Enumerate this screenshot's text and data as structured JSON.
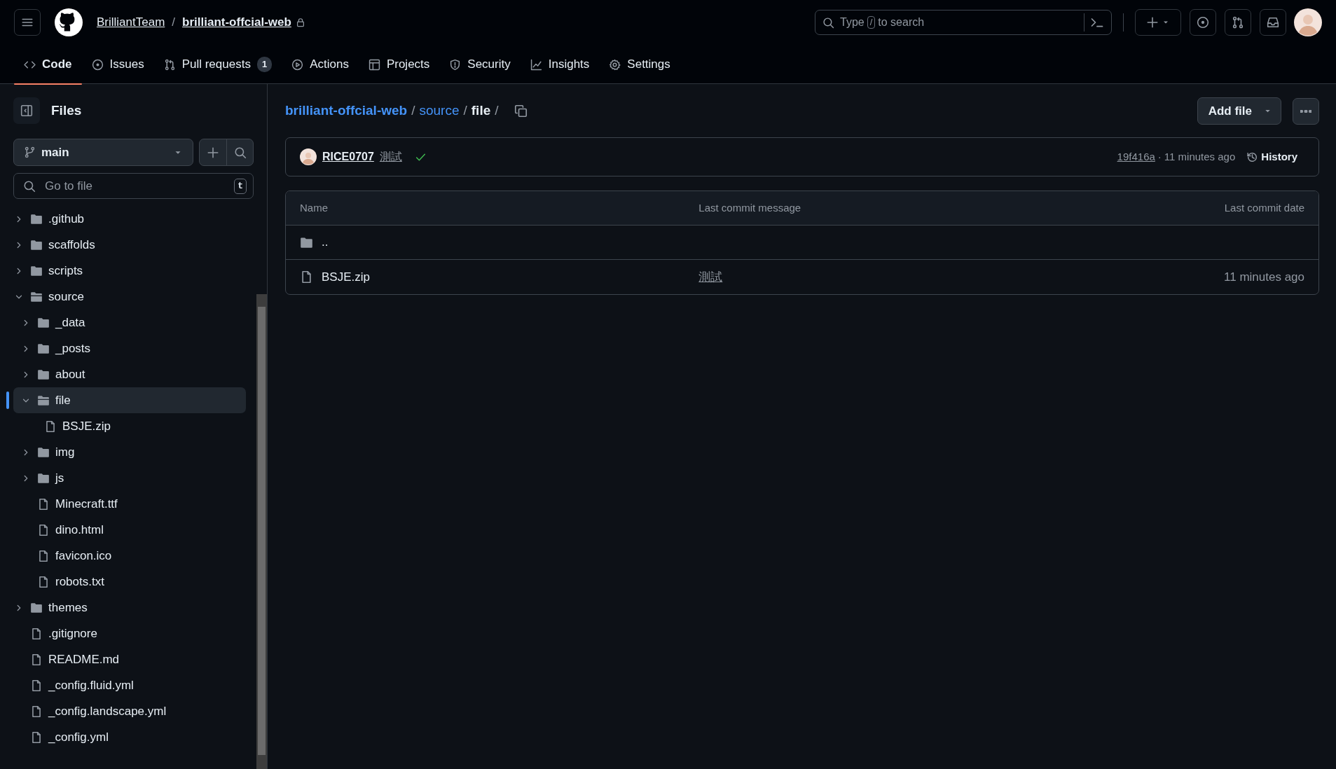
{
  "header": {
    "owner": "BrilliantTeam",
    "separator": "/",
    "repo": "brilliant-offcial-web",
    "private": true,
    "search": {
      "placeholder_before": "Type",
      "key": "/",
      "placeholder_after": "to search"
    }
  },
  "tabs": [
    {
      "label": "Code",
      "selected": true
    },
    {
      "label": "Issues",
      "selected": false
    },
    {
      "label": "Pull requests",
      "selected": false,
      "count": "1"
    },
    {
      "label": "Actions",
      "selected": false
    },
    {
      "label": "Projects",
      "selected": false
    },
    {
      "label": "Security",
      "selected": false
    },
    {
      "label": "Insights",
      "selected": false
    },
    {
      "label": "Settings",
      "selected": false
    }
  ],
  "sidebar": {
    "title": "Files",
    "branch": "main",
    "file_search": {
      "placeholder": "Go to file",
      "shortcut": "t"
    },
    "tree": [
      {
        "name": ".github",
        "kind": "folder",
        "expanded": false,
        "selected": false
      },
      {
        "name": "scaffolds",
        "kind": "folder",
        "expanded": false,
        "selected": false
      },
      {
        "name": "scripts",
        "kind": "folder",
        "expanded": false,
        "selected": false
      },
      {
        "name": "source",
        "kind": "folder",
        "expanded": true,
        "selected": false,
        "children": [
          {
            "name": "_data",
            "kind": "folder",
            "expanded": false,
            "selected": false
          },
          {
            "name": "_posts",
            "kind": "folder",
            "expanded": false,
            "selected": false
          },
          {
            "name": "about",
            "kind": "folder",
            "expanded": false,
            "selected": false
          },
          {
            "name": "file",
            "kind": "folder",
            "expanded": true,
            "selected": true,
            "children": [
              {
                "name": "BSJE.zip",
                "kind": "file",
                "selected": false
              }
            ]
          },
          {
            "name": "img",
            "kind": "folder",
            "expanded": false,
            "selected": false
          },
          {
            "name": "js",
            "kind": "folder",
            "expanded": false,
            "selected": false
          },
          {
            "name": "Minecraft.ttf",
            "kind": "file",
            "selected": false
          },
          {
            "name": "dino.html",
            "kind": "file",
            "selected": false
          },
          {
            "name": "favicon.ico",
            "kind": "file",
            "selected": false
          },
          {
            "name": "robots.txt",
            "kind": "file",
            "selected": false
          }
        ]
      },
      {
        "name": "themes",
        "kind": "folder",
        "expanded": false,
        "selected": false
      },
      {
        "name": ".gitignore",
        "kind": "file",
        "selected": false
      },
      {
        "name": "README.md",
        "kind": "file",
        "selected": false
      },
      {
        "name": "_config.fluid.yml",
        "kind": "file",
        "selected": false
      },
      {
        "name": "_config.landscape.yml",
        "kind": "file",
        "selected": false
      },
      {
        "name": "_config.yml",
        "kind": "file",
        "selected": false
      }
    ]
  },
  "breadcrumb": [
    {
      "label": "brilliant-offcial-web",
      "kind": "link",
      "separator": "/"
    },
    {
      "label": "source",
      "kind": "link",
      "separator": "/"
    },
    {
      "label": "file",
      "kind": "current",
      "separator": "/"
    }
  ],
  "add_file": "Add file",
  "commit": {
    "author": "RICE0707",
    "message": "測試",
    "checks_passed": true,
    "hash": "19f416a",
    "separator": "·",
    "time": "11 minutes ago",
    "history": "History"
  },
  "table": {
    "columns": [
      "Name",
      "Last commit message",
      "Last commit date"
    ],
    "rows": [
      {
        "kind": "parent",
        "name": ".."
      },
      {
        "kind": "file",
        "name": "BSJE.zip",
        "message": "測試",
        "date": "11 minutes ago"
      }
    ]
  }
}
